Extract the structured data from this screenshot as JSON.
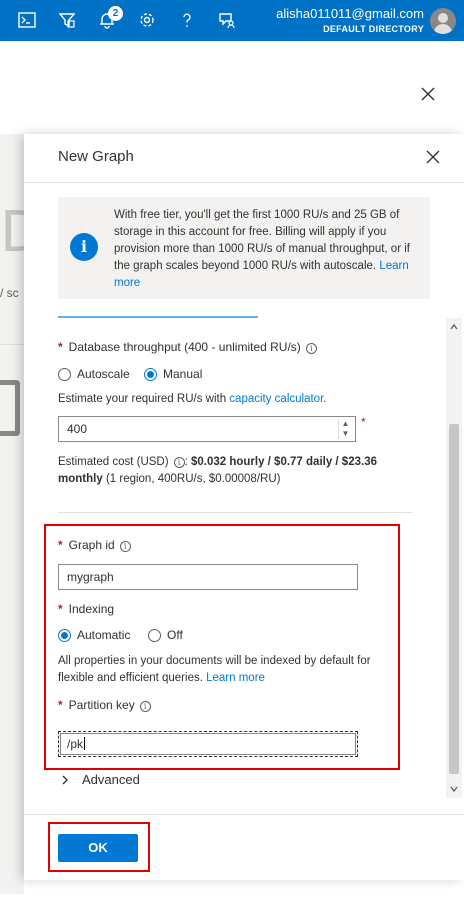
{
  "topbar": {
    "notifications_count": "2",
    "account_email": "alisha011011@gmail.com",
    "account_directory": "DEFAULT DIRECTORY",
    "icons": [
      "cloud-shell-icon",
      "directory-filter-icon",
      "notifications-icon",
      "settings-icon",
      "help-icon",
      "feedback-icon"
    ]
  },
  "background": {
    "big_letter": "D",
    "small_text": "/ sc"
  },
  "panel": {
    "title": "New Graph",
    "info_text": "With free tier, you'll get the first 1000 RU/s and 25 GB of storage in this account for free. Billing will apply if you provision more than 1000 RU/s of manual throughput, or if the graph scales beyond 1000 RU/s with autoscale.",
    "info_link": "Learn more",
    "throughput": {
      "label": "Database throughput (400 - unlimited RU/s)",
      "options": [
        "Autoscale",
        "Manual"
      ],
      "selected": "Manual",
      "estimate_prefix": "Estimate your required RU/s with ",
      "estimate_link": "capacity calculator",
      "estimate_suffix": ".",
      "value": "400",
      "cost_label": "Estimated cost (USD)",
      "cost_bold": "$0.032 hourly / $0.77 daily / $23.36 monthly",
      "cost_detail": "(1 region, 400RU/s, $0.00008/RU)"
    },
    "graph_id": {
      "label": "Graph id",
      "value": "mygraph"
    },
    "indexing": {
      "label": "Indexing",
      "options": [
        "Automatic",
        "Off"
      ],
      "selected": "Automatic",
      "description": "All properties in your documents will be indexed by default for flexible and efficient queries.",
      "link": "Learn more"
    },
    "partition_key": {
      "label": "Partition key",
      "value": "/pk"
    },
    "advanced_label": "Advanced",
    "ok_label": "OK"
  },
  "colors": {
    "topbar": "#0072c6",
    "primary": "#0078d4",
    "required": "#a4262c",
    "highlight": "#e00000"
  }
}
